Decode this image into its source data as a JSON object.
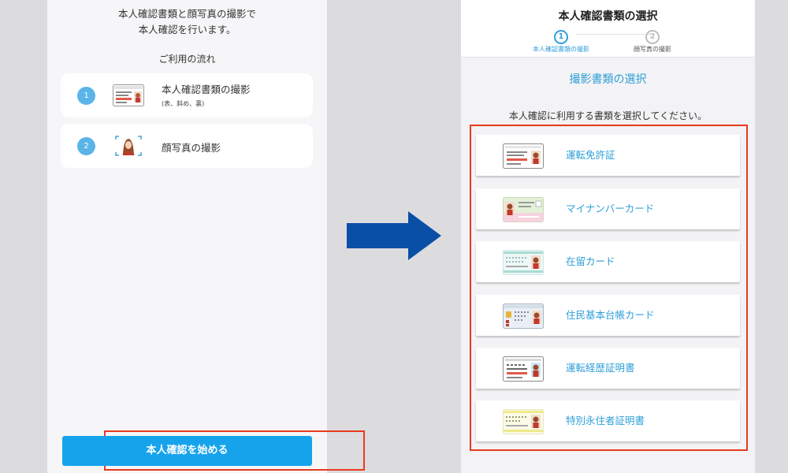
{
  "left": {
    "intro_line1": "本人確認書類と顔写真の撮影で",
    "intro_line2": "本人確認を行います。",
    "flow_title": "ご利用の流れ",
    "steps": [
      {
        "num": "1",
        "label": "本人確認書類の撮影",
        "sub": "(表、斜め、裏)",
        "icon": "id-card-icon"
      },
      {
        "num": "2",
        "label": "顔写真の撮影",
        "icon": "face-photo-icon"
      }
    ],
    "start_button": "本人確認を始める"
  },
  "right": {
    "title": "本人確認書類の選択",
    "steps": [
      {
        "num": "1",
        "label": "本人確認書類の撮影",
        "state": "active"
      },
      {
        "num": "2",
        "label": "顔写真の撮影",
        "state": "inactive"
      }
    ],
    "section_title": "撮影書類の選択",
    "instruction": "本人確認に利用する書類を選択してください。",
    "documents": [
      {
        "label": "運転免許証",
        "icon": "drivers-license-icon"
      },
      {
        "label": "マイナンバーカード",
        "icon": "my-number-card-icon"
      },
      {
        "label": "在留カード",
        "icon": "residence-card-icon"
      },
      {
        "label": "住民基本台帳カード",
        "icon": "resident-registry-card-icon"
      },
      {
        "label": "運転経歴証明書",
        "icon": "driving-history-certificate-icon"
      },
      {
        "label": "特別永住者証明書",
        "icon": "special-permanent-resident-certificate-icon"
      }
    ]
  },
  "colors": {
    "accent_blue": "#2f9fd8",
    "button_blue": "#16a3ec",
    "highlight_red": "#e8391e",
    "arrow_blue": "#0a4fa6",
    "step_circle": "#5ab4e8"
  }
}
